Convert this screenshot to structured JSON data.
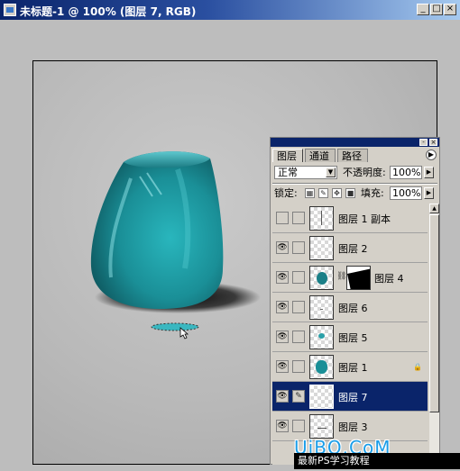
{
  "window": {
    "title": "未标题-1 @ 100% (图层 7, RGB)",
    "min_glyph": "_",
    "max_glyph": "□",
    "close_glyph": "×"
  },
  "panel": {
    "tabs": [
      {
        "label": "图层"
      },
      {
        "label": "通道"
      },
      {
        "label": "路径"
      }
    ],
    "blend_mode": "正常",
    "opacity_label": "不透明度:",
    "opacity_value": "100%",
    "lock_label": "锁定:",
    "fill_label": "填充:",
    "fill_value": "100%",
    "layers": [
      {
        "name": "图层 1 副本",
        "visible": false
      },
      {
        "name": "图层 2",
        "visible": true
      },
      {
        "name": "图层 4",
        "visible": true,
        "has_mask": true
      },
      {
        "name": "图层 6",
        "visible": true
      },
      {
        "name": "图层 5",
        "visible": true
      },
      {
        "name": "图层 1",
        "visible": true,
        "locked": true
      },
      {
        "name": "图层 7",
        "visible": true,
        "selected": true
      },
      {
        "name": "图层 3",
        "visible": true
      }
    ]
  },
  "watermark": "UiBQ.CoM",
  "footer": "最新PS学习教程",
  "colors": {
    "title_bar": "#0a246a",
    "selection": "#0a246a",
    "vase": "#1f8f96"
  }
}
